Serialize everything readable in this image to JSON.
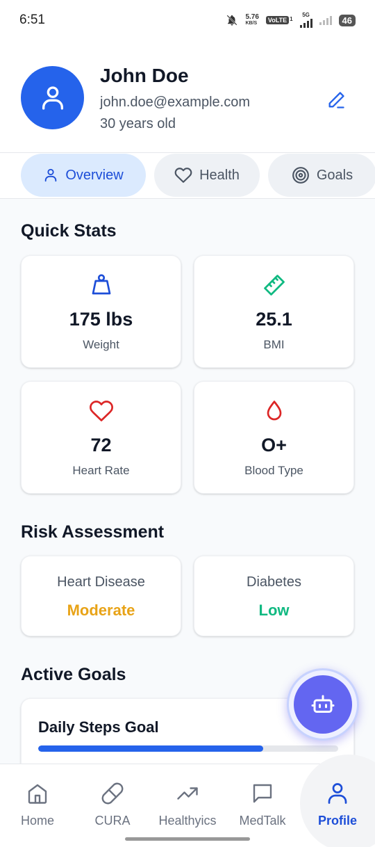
{
  "status_bar": {
    "time": "6:51",
    "net_speed_top": "5.76",
    "net_speed_unit": "KB/S",
    "volte": "VoLTE",
    "volte_sim": "1",
    "network": "5G",
    "battery": "46"
  },
  "profile": {
    "name": "John Doe",
    "email": "john.doe@example.com",
    "age": "30 years old"
  },
  "tabs": [
    {
      "label": "Overview",
      "icon": "user-icon",
      "active": true
    },
    {
      "label": "Health",
      "icon": "heart-icon",
      "active": false
    },
    {
      "label": "Goals",
      "icon": "target-icon",
      "active": false
    }
  ],
  "quick_stats": {
    "title": "Quick Stats",
    "items": [
      {
        "value": "175 lbs",
        "label": "Weight",
        "icon": "weight-icon",
        "color": "#1d4ed8"
      },
      {
        "value": "25.1",
        "label": "BMI",
        "icon": "ruler-icon",
        "color": "#10b981"
      },
      {
        "value": "72",
        "label": "Heart Rate",
        "icon": "heart-icon",
        "color": "#dc2626"
      },
      {
        "value": "O+",
        "label": "Blood Type",
        "icon": "droplet-icon",
        "color": "#dc2626"
      }
    ]
  },
  "risk_assessment": {
    "title": "Risk Assessment",
    "items": [
      {
        "label": "Heart Disease",
        "value": "Moderate",
        "color": "#e8a317"
      },
      {
        "label": "Diabetes",
        "value": "Low",
        "color": "#10b981"
      }
    ]
  },
  "active_goals": {
    "title": "Active Goals",
    "items": [
      {
        "title": "Daily Steps Goal",
        "progress": 0.75
      }
    ]
  },
  "fab": {
    "icon": "bot-icon"
  },
  "bottom_nav": [
    {
      "label": "Home",
      "icon": "home-icon",
      "active": false
    },
    {
      "label": "CURA",
      "icon": "pill-icon",
      "active": false
    },
    {
      "label": "Healthyics",
      "icon": "trending-up-icon",
      "active": false
    },
    {
      "label": "MedTalk",
      "icon": "chat-icon",
      "active": false
    },
    {
      "label": "Profile",
      "icon": "user-icon",
      "active": true
    }
  ],
  "colors": {
    "primary": "#2563eb",
    "fab": "#6366f1",
    "active_tab_bg": "#dbeafe"
  }
}
